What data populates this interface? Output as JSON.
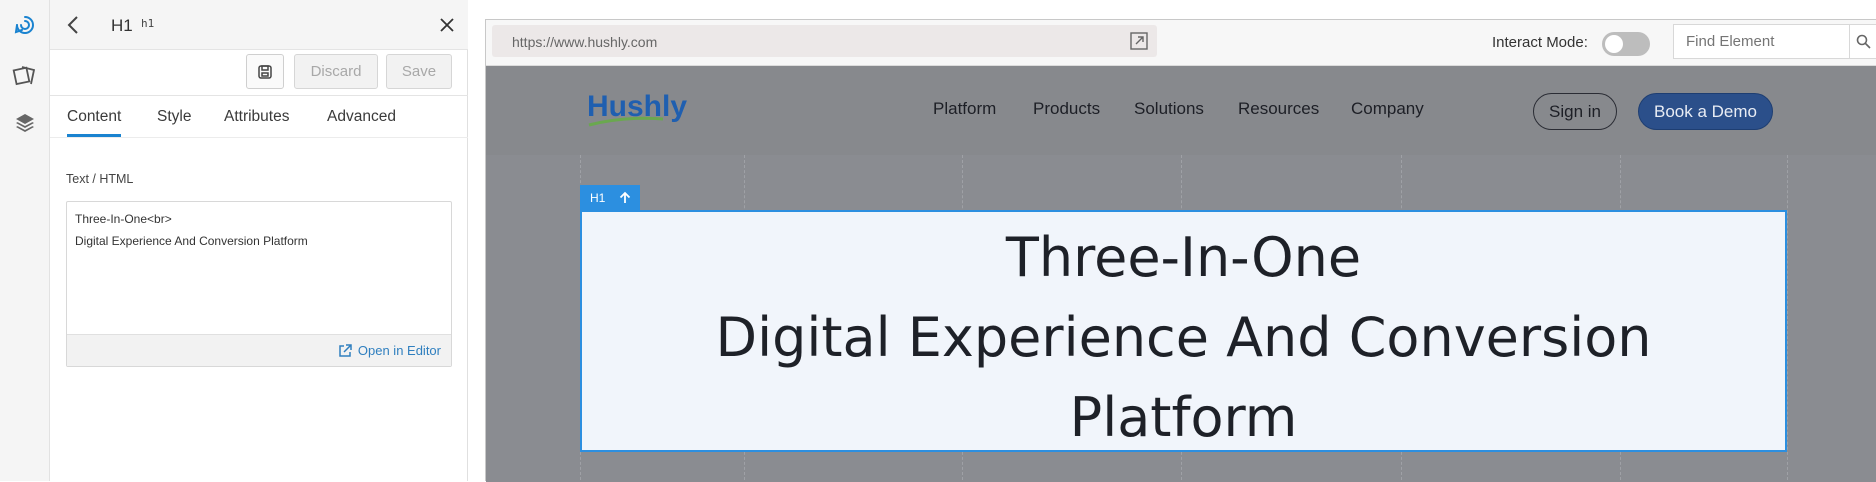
{
  "panel": {
    "element_title": "H1",
    "element_tag": "h1",
    "discard_label": "Discard",
    "save_label": "Save",
    "tabs": [
      "Content",
      "Style",
      "Attributes",
      "Advanced"
    ],
    "active_tab": "Content",
    "field_label": "Text / HTML",
    "html_lines": [
      "Three-In-One<br>",
      "Digital Experience And Conversion Platform"
    ],
    "open_editor_label": "Open in Editor"
  },
  "browser": {
    "url": "https://www.hushly.com",
    "interact_mode_label": "Interact Mode:",
    "interact_mode_on": false,
    "find_placeholder": "Find Element"
  },
  "site": {
    "logo_text": "Hushly",
    "nav": [
      "Platform",
      "Products",
      "Solutions",
      "Resources",
      "Company"
    ],
    "sign_in_label": "Sign in",
    "demo_label": "Book a Demo",
    "selected_tag_label": "H1",
    "heading_lines": [
      "Three-In-One",
      "Digital Experience And Conversion",
      "Platform"
    ]
  },
  "colors": {
    "accent": "#1a83d0",
    "selection": "#2c8fe0",
    "demo_button": "#2b4f8a",
    "logo_blue": "#1f5fb0",
    "logo_green": "#6aa84f"
  }
}
